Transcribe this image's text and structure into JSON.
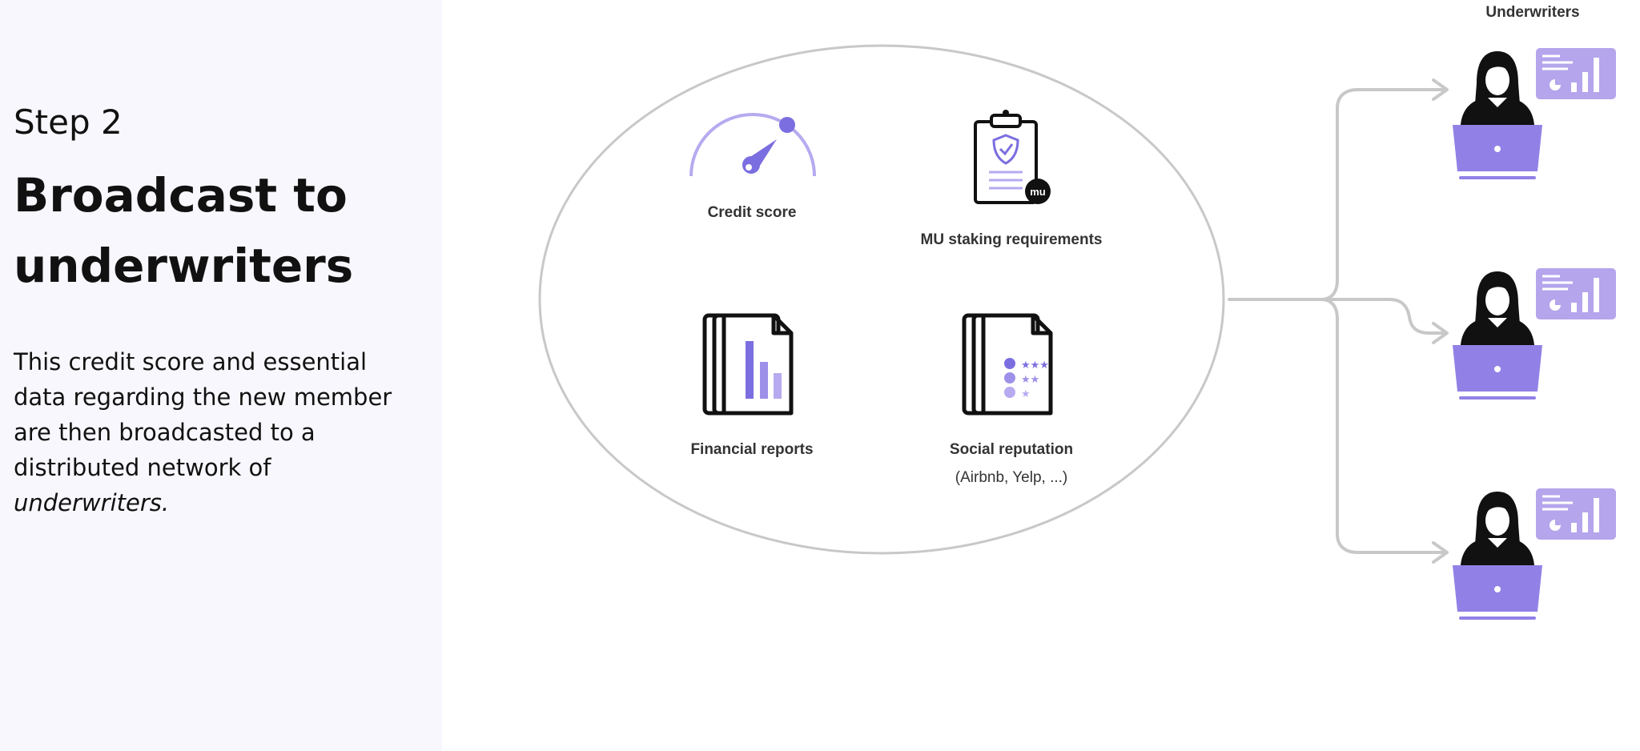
{
  "left_panel": {
    "step": "Step 2",
    "title": "Broadcast to underwriters",
    "description_main": "This credit score and essential data regarding the new member are then broadcasted to a distributed network of",
    "description_emphasis": "underwriters."
  },
  "diagram": {
    "items": {
      "credit_score": "Credit score",
      "mu_staking": "MU staking requirements",
      "financial_reports": "Financial reports",
      "social_reputation": "Social reputation",
      "social_reputation_examples": "(Airbnb, Yelp, ...)"
    },
    "badge_text": "mu",
    "underwriters_heading": "Underwriters",
    "underwriter_count": 3
  },
  "colors": {
    "accent": "#7b6ee0",
    "accent_light": "#b7aaf0",
    "laptop": "#9181e6",
    "dashboard": "#b4a5ec",
    "connector": "#c8c8c8",
    "panel_bg": "#f8f7fd"
  },
  "icons": [
    "gauge-icon",
    "clipboard-shield-icon",
    "financial-documents-icon",
    "rating-documents-icon",
    "underwriter-person-icon",
    "laptop-icon",
    "dashboard-icon",
    "arrow-icon"
  ]
}
